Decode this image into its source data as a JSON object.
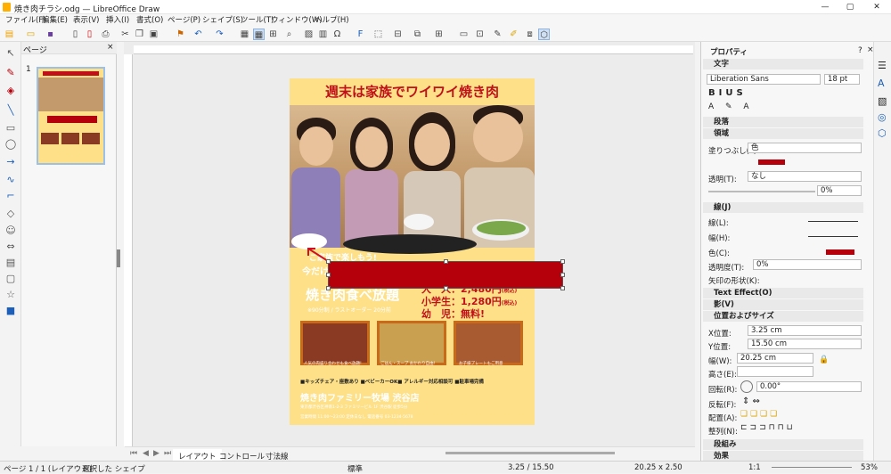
{
  "window": {
    "title": "焼き肉チラシ.odg — LibreOffice Draw",
    "min": "—",
    "max": "▢",
    "close": "✕"
  },
  "menu": [
    "ファイル(F)",
    "編集(E)",
    "表示(V)",
    "挿入(I)",
    "書式(O)",
    "ページ(P)",
    "シェイプ(S)",
    "ツール(T)",
    "ウィンドウ(W)",
    "ヘルプ(H)"
  ],
  "pages_panel": {
    "title": "ページ",
    "close": "×",
    "thumb_number": "1"
  },
  "flyer": {
    "title": "週末は家族でワイワイ焼き肉",
    "hidden_line1": "ご家族で楽しもう!",
    "hidden_line2": "今だけ",
    "main_offer": "焼き肉食べ放題",
    "sub_offer": "※90分制 / ラストオーダー 20分前",
    "price_adult": "大　人：2,480円",
    "price_adult_note": "(税込)",
    "price_child": "小学生：1,280円",
    "price_child_note": "(税込)",
    "price_infant": "幼　児：無料!",
    "caption1": "人気の肉盛り合わせも食べ放題!",
    "caption2": "ごはん・スープ おかわり自由!",
    "caption3": "お子様プレートもご用意",
    "features": "■キッズチェア・座敷あり ■ベビーカーOK■ アレルギー対応相談可 ■駐車場完備",
    "shop_name": "焼き肉ファミリー牧場 渋谷店",
    "shop_address": "東京都渋谷区神南1-2-3 ファミリービル 1F  渋谷駅 徒歩5分",
    "shop_hours": "営業時間 11:00〜23:00  定休日なし  電話番号 03-1234-5678"
  },
  "tabs": [
    "レイアウト",
    "コントロール",
    "寸法線"
  ],
  "status": {
    "page": "ページ 1 / 1 (レイアウト)",
    "selection": "選択した シェイプ",
    "style": "標準",
    "position": "3.25 / 15.50",
    "size": "20.25 x 2.50",
    "scale": "1:1",
    "zoom": "53%"
  },
  "sidebar": {
    "title": "プロパティ",
    "help": "?",
    "close": "×",
    "char_section": "文字",
    "font_name": "Liberation Sans",
    "font_size": "18 pt",
    "para_section": "段落",
    "area_section": "領域",
    "fill_label": "塗りつぶし(F):",
    "fill_value": "色",
    "transparency_label": "透明(T):",
    "transparency_value": "なし",
    "transparency_pct": "0%",
    "line_section": "線(J)",
    "line_label": "線(L):",
    "width_label": "幅(H):",
    "color_label": "色(C):",
    "line_transparency_label": "透明度(T):",
    "line_transparency_value": "0%",
    "arrow_label": "矢印の形状(K):",
    "text_effect_section": "Text Effect(O)",
    "shadow_section": "影(V)",
    "pos_section": "位置およびサイズ",
    "x_label": "X位置:",
    "x_value": "3.25 cm",
    "y_label": "Y位置:",
    "y_value": "15.50 cm",
    "w_label": "幅(W):",
    "w_value": "20.25 cm",
    "h_label": "高さ(E):",
    "h_value": "",
    "rot_label": "回転(R):",
    "rot_value": "0.00°",
    "flip_label": "反転(F):",
    "arrange_label": "配置(A):",
    "align_label": "整列(N):",
    "group_section": "段組み",
    "effect_section": "効果"
  },
  "colors": {
    "accent": "#b5000b",
    "flyer_bg": "#fde088",
    "title_red": "#c0101a"
  }
}
